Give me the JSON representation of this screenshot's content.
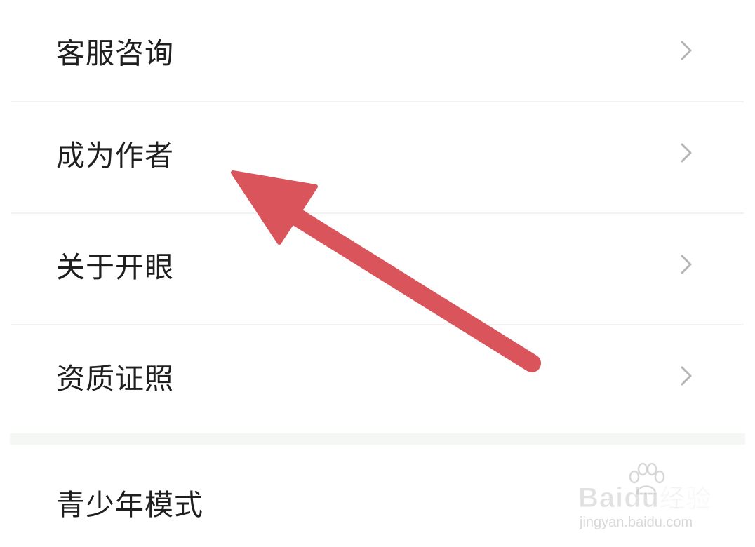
{
  "menu": {
    "items": [
      {
        "label": "客服咨询"
      },
      {
        "label": "成为作者"
      },
      {
        "label": "关于开眼"
      },
      {
        "label": "资质证照"
      },
      {
        "label": "青少年模式"
      }
    ]
  },
  "watermark": {
    "brand": "Bai",
    "brand_tail": "du",
    "brand_cn": "经验",
    "url": "jingyan.baidu.com"
  },
  "colors": {
    "arrow": "#d9555b",
    "text": "#1f1f1f",
    "chevron": "#b5b5b5"
  },
  "icons": [
    "chevron-right-icon",
    "annotation-arrow-icon",
    "baidu-paw-icon"
  ]
}
